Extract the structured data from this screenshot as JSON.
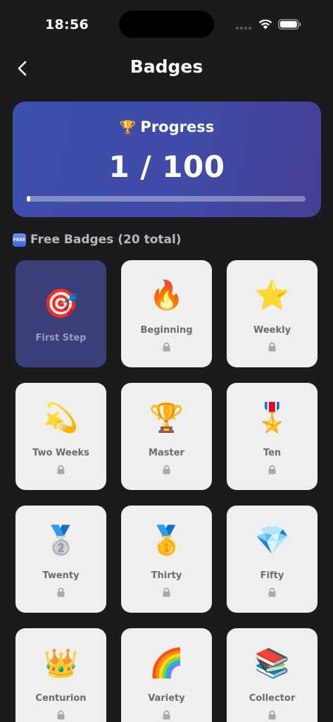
{
  "status_bar": {
    "time": "18:56"
  },
  "header": {
    "title": "Badges"
  },
  "progress": {
    "heading": "Progress",
    "heading_icon": "trophy-icon",
    "value_text": "1 / 100",
    "fraction": 0.01
  },
  "section": {
    "icon_text": "FREE",
    "title": "Free Badges (20 total)"
  },
  "badges": [
    {
      "label": "First Step",
      "emoji": "🎯",
      "earned": true
    },
    {
      "label": "Beginning",
      "emoji": "🔥",
      "earned": false
    },
    {
      "label": "Weekly",
      "emoji": "⭐",
      "earned": false
    },
    {
      "label": "Two Weeks",
      "emoji": "💫",
      "earned": false
    },
    {
      "label": "Master",
      "emoji": "🏆",
      "earned": false
    },
    {
      "label": "Ten",
      "emoji": "🎖️",
      "earned": false
    },
    {
      "label": "Twenty",
      "emoji": "🥈",
      "earned": false
    },
    {
      "label": "Thirty",
      "emoji": "🥇",
      "earned": false
    },
    {
      "label": "Fifty",
      "emoji": "💎",
      "earned": false
    },
    {
      "label": "Centurion",
      "emoji": "👑",
      "earned": false
    },
    {
      "label": "Variety",
      "emoji": "🌈",
      "earned": false
    },
    {
      "label": "Collector",
      "emoji": "📚",
      "earned": false
    }
  ],
  "colors": {
    "background": "#1b1b1e",
    "card_locked": "#efefef",
    "card_earned": "#3a3f7a",
    "progress_card": "#404ca7"
  }
}
